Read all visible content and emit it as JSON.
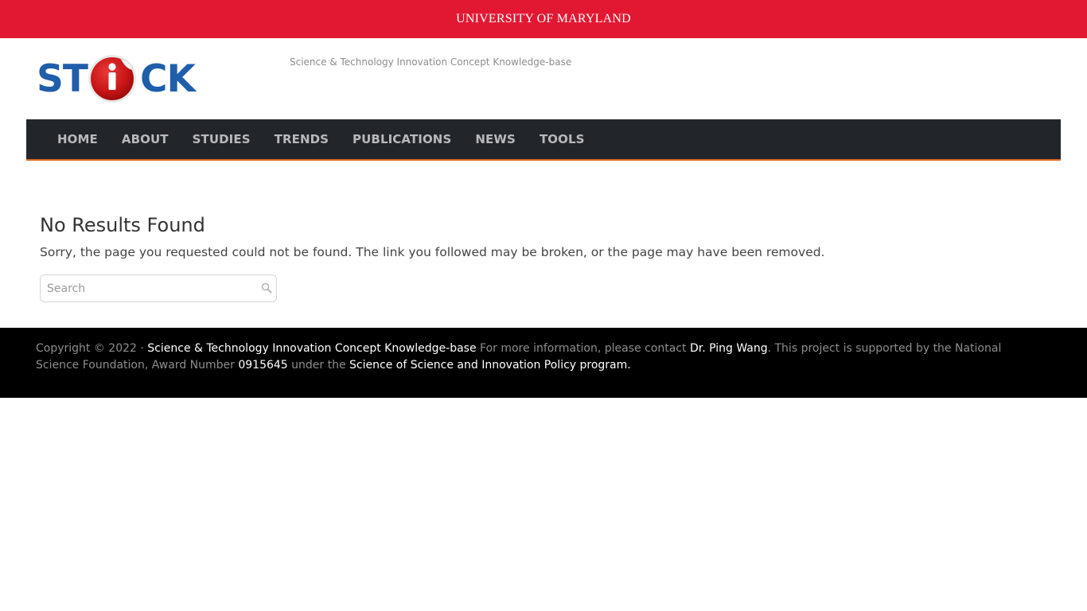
{
  "top_bar": {
    "university_label": "UNIVERSITY OF MARYLAND",
    "background": "#e21833"
  },
  "header": {
    "logo": {
      "text_left": "ST",
      "text_right": "CK",
      "badge_letter": "i",
      "color": "#1f5eaa"
    },
    "tagline": "Science & Technology Innovation Concept Knowledge-base"
  },
  "nav": {
    "items": [
      {
        "label": "HOME"
      },
      {
        "label": "ABOUT"
      },
      {
        "label": "STUDIES"
      },
      {
        "label": "TRENDS"
      },
      {
        "label": "PUBLICATIONS"
      },
      {
        "label": "NEWS"
      },
      {
        "label": "TOOLS"
      }
    ],
    "accent": "#e06a24"
  },
  "main": {
    "title": "No Results Found",
    "message": "Sorry, the page you requested could not be found. The link you followed may be broken, or the page may have been removed.",
    "search": {
      "placeholder": "Search",
      "icon": "search-icon"
    }
  },
  "footer": {
    "copyright": "Copyright © 2022 · ",
    "site_link": "Science & Technology Innovation Concept Knowledge-base",
    "contact_prefix": " For more information, please contact ",
    "contact_link": "Dr. Ping Wang",
    "support_text": ". This project is supported by the National Science Foundation, Award Number ",
    "award_link": "0915645",
    "program_prefix": " under the ",
    "program_link": "Science of Science and Innovation Policy program."
  }
}
